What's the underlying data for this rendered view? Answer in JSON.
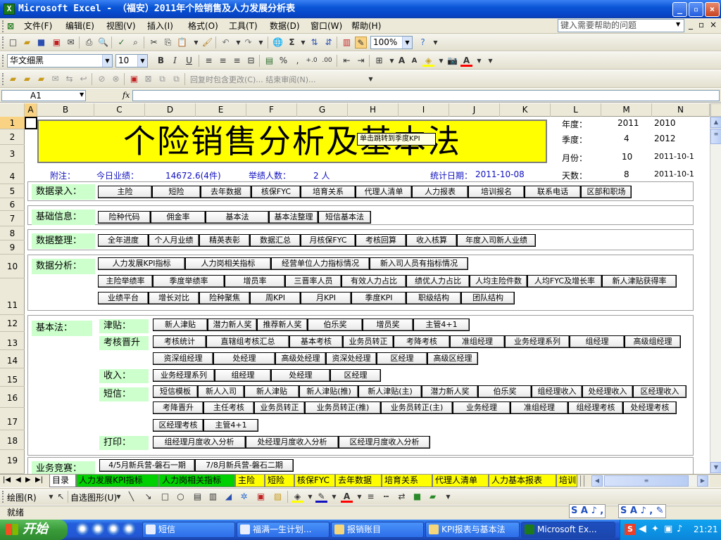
{
  "window": {
    "title": "Microsoft Excel - （福安）2011年个险销售及人力发展分析表"
  },
  "menu": {
    "items": [
      "文件(F)",
      "编辑(E)",
      "视图(V)",
      "插入(I)",
      "格式(O)",
      "工具(T)",
      "数据(D)",
      "窗口(W)",
      "帮助(H)"
    ],
    "help_placeholder": "键入需要帮助的问题"
  },
  "toolbar": {
    "zoom": "100%",
    "font_name": "华文细黑",
    "font_size": "10",
    "review_text": "回复时包含更改(C)...  结束审阅(N)..."
  },
  "formula": {
    "name_box": "A1",
    "fx": "fx"
  },
  "columns": [
    "A",
    "B",
    "C",
    "D",
    "E",
    "F",
    "G",
    "H",
    "I",
    "J",
    "K",
    "L",
    "M",
    "N"
  ],
  "rows": [
    "1",
    "2",
    "3",
    "4",
    "5",
    "6",
    "7",
    "8",
    "9",
    "10",
    "11",
    "12",
    "13",
    "14",
    "15",
    "16",
    "17",
    "18",
    "19"
  ],
  "sheet": {
    "banner": "个险销售分析及基本法",
    "side_labels": [
      {
        "label": "年度：",
        "m": "2011",
        "n": "2010"
      },
      {
        "label": "季度：",
        "m": "4",
        "n": "2012"
      },
      {
        "label": "月份：",
        "m": "10",
        "n": "2011-10-1"
      },
      {
        "label": "天数：",
        "m": "8",
        "n": "2011-10-1"
      }
    ],
    "note": {
      "label": "附注：",
      "today_label": "今日业绩：",
      "today_value": "14672.6(4件)",
      "people_label": "举绩人数：",
      "people_value": "2 人",
      "date_label": "统计日期：",
      "date_value": "2011-10-08"
    },
    "sections": {
      "data_entry": {
        "title": "数据录入：",
        "buttons": [
          "主险",
          "短险",
          "去年数据",
          "核保FYC",
          "培育关系",
          "代理人清单",
          "人力报表",
          "培训报名",
          "联系电话",
          "区部和职场"
        ]
      },
      "basic_info": {
        "title": "基础信息：",
        "buttons": [
          "险种代码",
          "佣金率",
          "基本法",
          "基本法整理",
          "短信基本法"
        ]
      },
      "data_org": {
        "title": "数据整理：",
        "buttons": [
          "全年进度",
          "个人月业绩",
          "精英表彰",
          "数据汇总",
          "月核保FYC",
          "考核回算",
          "收入核算",
          "年度入司新人业绩"
        ]
      },
      "analysis": {
        "title": "数据分析：",
        "row1": [
          "人力发展KPI指标",
          "人力岗相关指标",
          "经营单位人力指标情况",
          "新入司人员有指标情况"
        ],
        "row2": [
          "主险举绩率",
          "季度举绩率",
          "增员率",
          "三晋率人员",
          "有效人力占比",
          "绩优人力占比",
          "人均主险件数",
          "人均FYC及增长率",
          "新人津贴获得率"
        ],
        "row3": [
          "业绩平台",
          "增长对比",
          "险种聚焦",
          "周KPI",
          "月KPI",
          "季度KPI",
          "职级结构",
          "团队结构"
        ]
      },
      "law": {
        "title": "基本法：",
        "allowance_label": "津贴：",
        "allowance": [
          "新人津贴",
          "潜力新人奖",
          "推荐新人奖",
          "伯乐奖",
          "增员奖",
          "主管4+1"
        ],
        "promo_label": "考核晋升",
        "promo_r1": [
          "考核统计",
          "直辖组考核汇总",
          "基本考核",
          "业务员转正",
          "考降考核",
          "准组经理",
          "业务经理系列",
          "组经理",
          "高级组经理"
        ],
        "promo_r2": [
          "资深组经理",
          "处经理",
          "高级处经理",
          "资深处经理",
          "区经理",
          "高级区经理"
        ],
        "income_label": "收入：",
        "income": [
          "业务经理系列",
          "组经理",
          "处经理",
          "区经理"
        ],
        "sms_label": "短信：",
        "sms_r1": [
          "短信模板",
          "新人入司",
          "新人津贴",
          "新人津贴(推)",
          "新人津贴(主)",
          "潜力新人奖",
          "伯乐奖",
          "组经理收入",
          "处经理收入",
          "区经理收入"
        ],
        "sms_r2": [
          "考降晋升",
          "主任考核",
          "业务员转正",
          "业务员转正(推)",
          "业务员转正(主)",
          "业务经理",
          "准组经理",
          "组经理考核",
          "处经理考核"
        ],
        "sms_r3": [
          "区经理考核",
          "主管4+1"
        ],
        "print_label": "打印：",
        "print": [
          "组经理月度收入分析",
          "处经理月度收入分析",
          "区经理月度收入分析"
        ]
      },
      "contest": {
        "title": "业务竞赛：",
        "buttons": [
          "4/5月新兵营-磐石一期",
          "7/8月新兵营-磐石二期"
        ]
      }
    },
    "tooltip": "单击跳转到季度KPI"
  },
  "tabs": [
    "目录",
    "人力发展KPI指标",
    "人力岗相关指标",
    "主险",
    "短险",
    "核保FYC",
    "去年数据",
    "培育关系",
    "代理人清单",
    "人力基本报表",
    "培训"
  ],
  "drawbar": {
    "draw_label": "绘图(R)",
    "autoshape_label": "自选图形(U)"
  },
  "status": "就绪",
  "taskbar": {
    "start": "开始",
    "tasks": [
      "短信",
      "福满一生计划...",
      "报销账目",
      "KPI报表与基本法",
      "Microsoft Ex..."
    ],
    "clock": "21:21"
  }
}
